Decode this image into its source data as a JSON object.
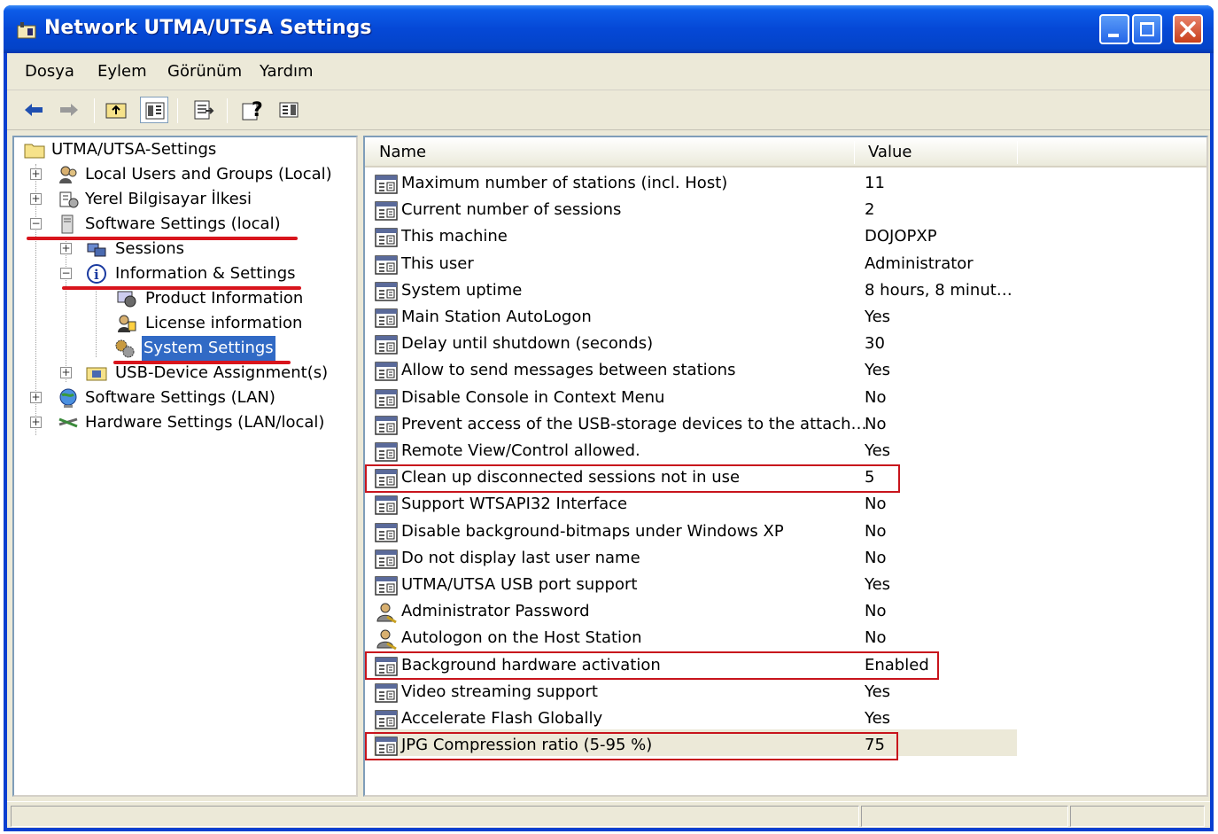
{
  "window": {
    "title": "Network UTMA/UTSA Settings",
    "title_color": "#ffffff",
    "titlebar_color": "#0548d6"
  },
  "menu": {
    "items": [
      "Dosya",
      "Eylem",
      "Görünüm",
      "Yardım"
    ]
  },
  "toolbar": {
    "buttons": [
      "back-arrow-icon",
      "forward-arrow-icon",
      "up-folder-icon",
      "show-tree-icon",
      "export-list-icon",
      "help-icon",
      "action-pane-icon"
    ]
  },
  "tree": {
    "root": "UTMA/UTSA-Settings",
    "items": [
      {
        "label": "Local Users and Groups (Local)",
        "expander": "+"
      },
      {
        "label": "Yerel Bilgisayar İlkesi",
        "expander": "+"
      },
      {
        "label": "Software Settings (local)",
        "expander": "−"
      },
      {
        "label": "Sessions",
        "expander": "+"
      },
      {
        "label": "Information & Settings",
        "expander": "−"
      },
      {
        "label": "Product Information",
        "expander": ""
      },
      {
        "label": "License information",
        "expander": ""
      },
      {
        "label": "System Settings",
        "expander": ""
      },
      {
        "label": "USB-Device Assignment(s)",
        "expander": "+"
      },
      {
        "label": "Software Settings (LAN)",
        "expander": "+"
      },
      {
        "label": "Hardware Settings (LAN/local)",
        "expander": "+"
      }
    ],
    "selected": "System Settings",
    "selected_color": "#316ac5"
  },
  "list": {
    "columns": [
      "Name",
      "Value"
    ],
    "rows": [
      {
        "name": "Maximum number of stations (incl. Host)",
        "value": "11",
        "icon": "setting-icon"
      },
      {
        "name": "Current number of sessions",
        "value": "2",
        "icon": "setting-icon"
      },
      {
        "name": "This machine",
        "value": "DOJOPXP",
        "icon": "setting-icon"
      },
      {
        "name": "This user",
        "value": "Administrator",
        "icon": "setting-icon"
      },
      {
        "name": "System uptime",
        "value": "8 hours, 8 minut…",
        "icon": "setting-icon"
      },
      {
        "name": "Main Station AutoLogon",
        "value": "Yes",
        "icon": "setting-icon"
      },
      {
        "name": "Delay until shutdown (seconds)",
        "value": "30",
        "icon": "setting-icon"
      },
      {
        "name": "Allow to send messages between stations",
        "value": "Yes",
        "icon": "setting-icon"
      },
      {
        "name": "Disable Console in Context Menu",
        "value": "No",
        "icon": "setting-icon"
      },
      {
        "name": "Prevent access of the USB-storage devices to the attach…",
        "value": "No",
        "icon": "setting-icon"
      },
      {
        "name": "Remote View/Control allowed.",
        "value": "Yes",
        "icon": "setting-icon"
      },
      {
        "name": "Clean up disconnected sessions not in use",
        "value": "5",
        "icon": "setting-icon"
      },
      {
        "name": "Support WTSAPI32  Interface",
        "value": "No",
        "icon": "setting-icon"
      },
      {
        "name": "Disable background-bitmaps under Windows XP",
        "value": "No",
        "icon": "setting-icon"
      },
      {
        "name": "Do not display last user name",
        "value": "No",
        "icon": "setting-icon"
      },
      {
        "name": "UTMA/UTSA USB port support",
        "value": "Yes",
        "icon": "setting-icon"
      },
      {
        "name": "Administrator Password",
        "value": "No",
        "icon": "user-key-icon"
      },
      {
        "name": "Autologon on the Host Station",
        "value": "No",
        "icon": "user-key-icon"
      },
      {
        "name": "Background hardware activation",
        "value": "Enabled",
        "icon": "setting-icon"
      },
      {
        "name": "Video streaming support",
        "value": "Yes",
        "icon": "setting-icon"
      },
      {
        "name": "Accelerate Flash Globally",
        "value": "Yes",
        "icon": "setting-icon"
      },
      {
        "name": "JPG Compression ratio (5-95 %)",
        "value": "75",
        "icon": "setting-icon"
      }
    ],
    "highlighted_rows": [
      "Clean up disconnected sessions not in use",
      "Background hardware activation",
      "JPG Compression ratio (5-95 %)"
    ],
    "highlight_color": "#c8141c"
  },
  "annotation_color": "#d8141c"
}
